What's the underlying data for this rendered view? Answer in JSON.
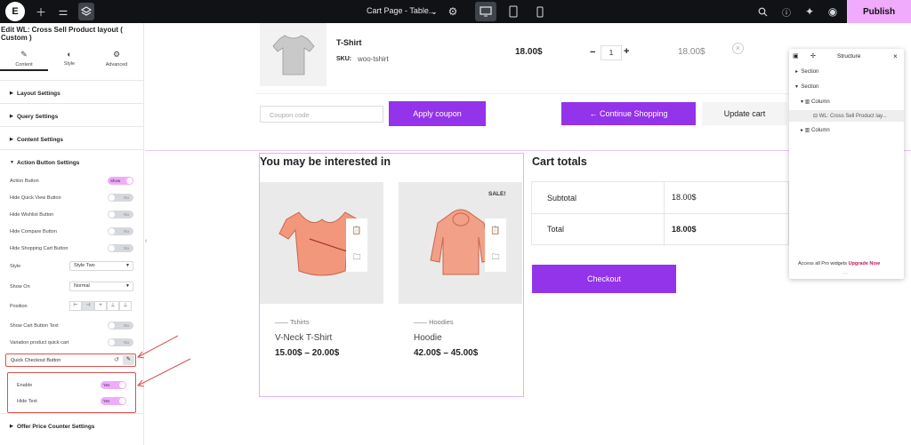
{
  "topbar": {
    "logo": "E",
    "page_name": "Cart Page - Table...",
    "publish_label": "Publish"
  },
  "panel": {
    "title": "Edit WL: Cross Sell Product layout ( Custom )",
    "tabs": [
      {
        "label": "Content",
        "icon": "pencil-icon"
      },
      {
        "label": "Style",
        "icon": "half-circle-icon"
      },
      {
        "label": "Advanced",
        "icon": "gear-icon"
      }
    ],
    "sections": [
      "Layout Settings",
      "Query Settings",
      "Content Settings",
      "Action Button Settings",
      "Offer Price Counter Settings"
    ],
    "controls": {
      "action_button": {
        "label": "Action Button",
        "value": "Show"
      },
      "hide_quick_view": {
        "label": "Hide Quick View Button",
        "value": "No"
      },
      "hide_wishlist": {
        "label": "Hide Wishlist Button",
        "value": "No"
      },
      "hide_compare": {
        "label": "Hide Compare Button",
        "value": "No"
      },
      "hide_cart": {
        "label": "Hide Shopping Cart Button",
        "value": "No"
      },
      "style": {
        "label": "Style",
        "value": "Style Two"
      },
      "show_on": {
        "label": "Show On",
        "value": "Normal"
      },
      "position": {
        "label": "Position"
      },
      "show_cart_text": {
        "label": "Show Cart Button Text",
        "value": "No"
      },
      "variation_quick_cart": {
        "label": "Variation product quick cart",
        "value": "No"
      },
      "quick_checkout": {
        "label": "Quick Checkout Button"
      },
      "enable": {
        "label": "Enable",
        "value": "Yes"
      },
      "hide_text": {
        "label": "Hide Text",
        "value": "Yes"
      }
    }
  },
  "cart": {
    "product_name": "T-Shirt",
    "sku_label": "SKU:",
    "sku_value": "woo-tshirt",
    "price": "18.00$",
    "qty_minus": "−",
    "qty": "1",
    "qty_plus": "+",
    "subtotal": "18.00$",
    "remove": "×",
    "coupon_placeholder": "Coupon code",
    "apply_coupon": "Apply coupon",
    "continue_shopping": "← Continue Shopping",
    "update_cart": "Update cart"
  },
  "cross_sell": {
    "heading": "You may be interested in",
    "products": [
      {
        "category": "Tshirts",
        "name": "V-Neck T-Shirt",
        "price": "15.00$ – 20.00$",
        "sale": ""
      },
      {
        "category": "Hoodies",
        "name": "Hoodie",
        "price": "42.00$ – 45.00$",
        "sale": "SALE!"
      }
    ]
  },
  "totals": {
    "heading": "Cart totals",
    "rows": [
      {
        "label": "Subtotal",
        "value": "18.00$"
      },
      {
        "label": "Total",
        "value": "18.00$"
      }
    ],
    "checkout": "Checkout"
  },
  "structure": {
    "title": "Structure",
    "items": [
      "Section",
      "Section",
      "Column",
      "WL: Cross Sell Product lay...",
      "Column"
    ],
    "footer_text": "Access all Pro widgets",
    "footer_link": "Upgrade Now"
  },
  "colors": {
    "accent": "#9333ea",
    "publish": "#f0abfc",
    "arrow": "#d9534f",
    "topbar": "#111215"
  }
}
